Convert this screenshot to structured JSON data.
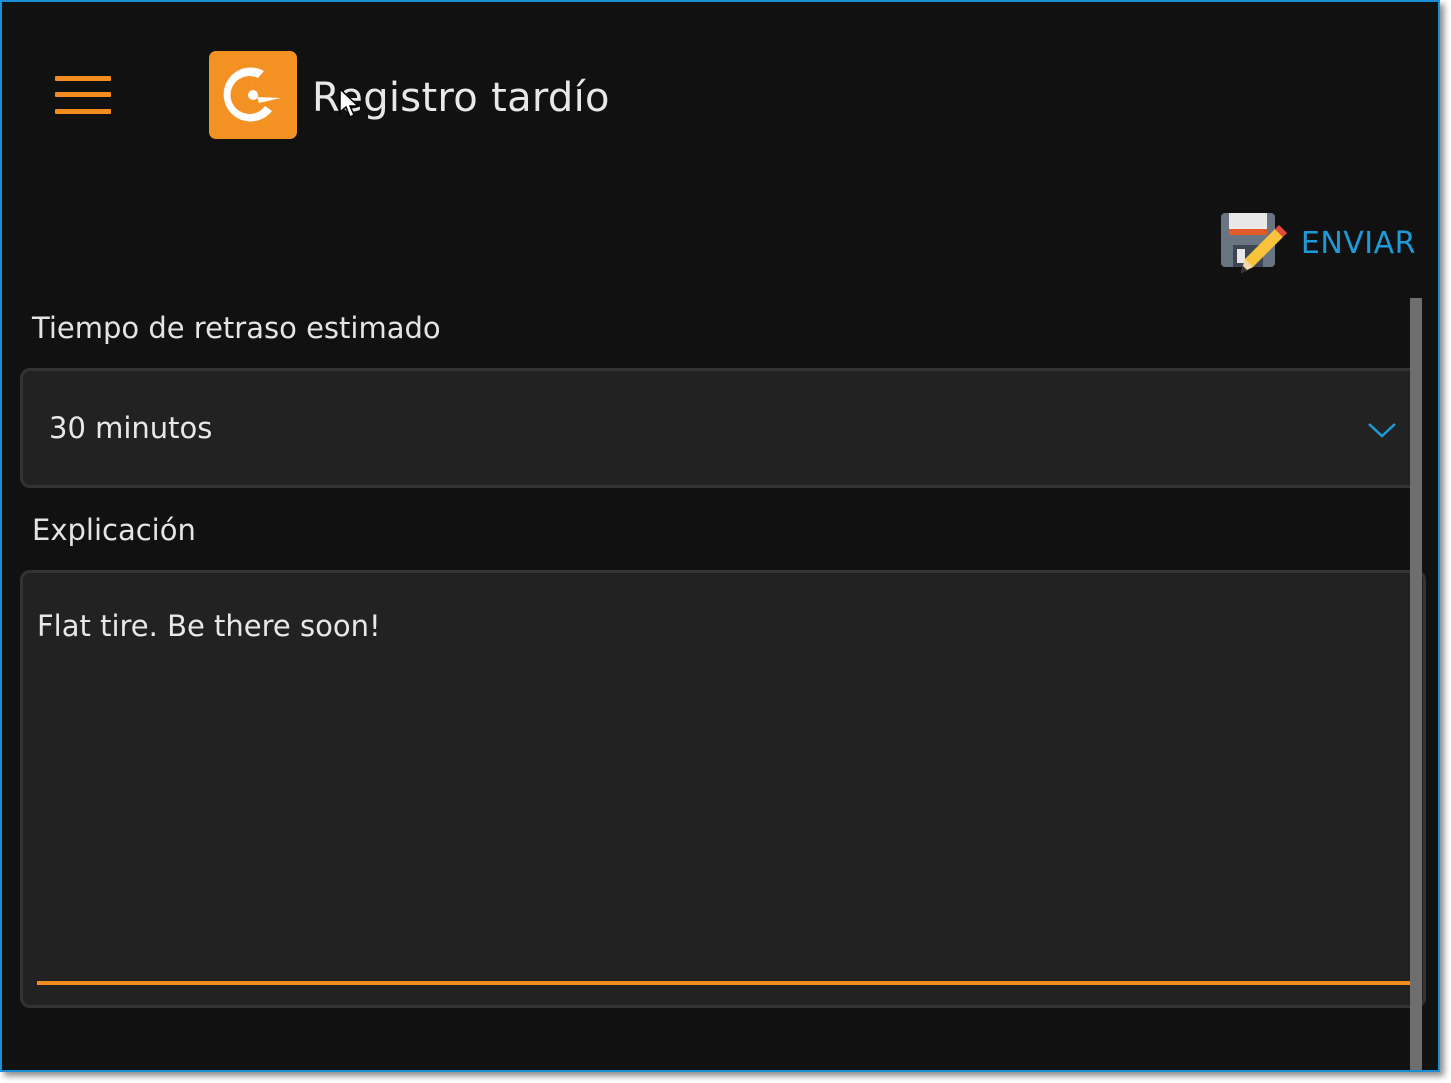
{
  "header": {
    "menu_icon": "hamburger-menu-icon",
    "logo_icon": "clock-logo-icon",
    "title": "Registro tardío"
  },
  "toolbar": {
    "send_label": "ENVIAR",
    "send_icon": "save-edit-icon"
  },
  "form": {
    "delay": {
      "label": "Tiempo de retraso estimado",
      "selected_value": "30 minutos"
    },
    "explanation": {
      "label": "Explicación",
      "value": "Flat tire. Be there soon!"
    }
  },
  "colors": {
    "accent": "#f28c1e",
    "link": "#1e9ad9",
    "background": "#111111",
    "field_background": "#222222"
  }
}
